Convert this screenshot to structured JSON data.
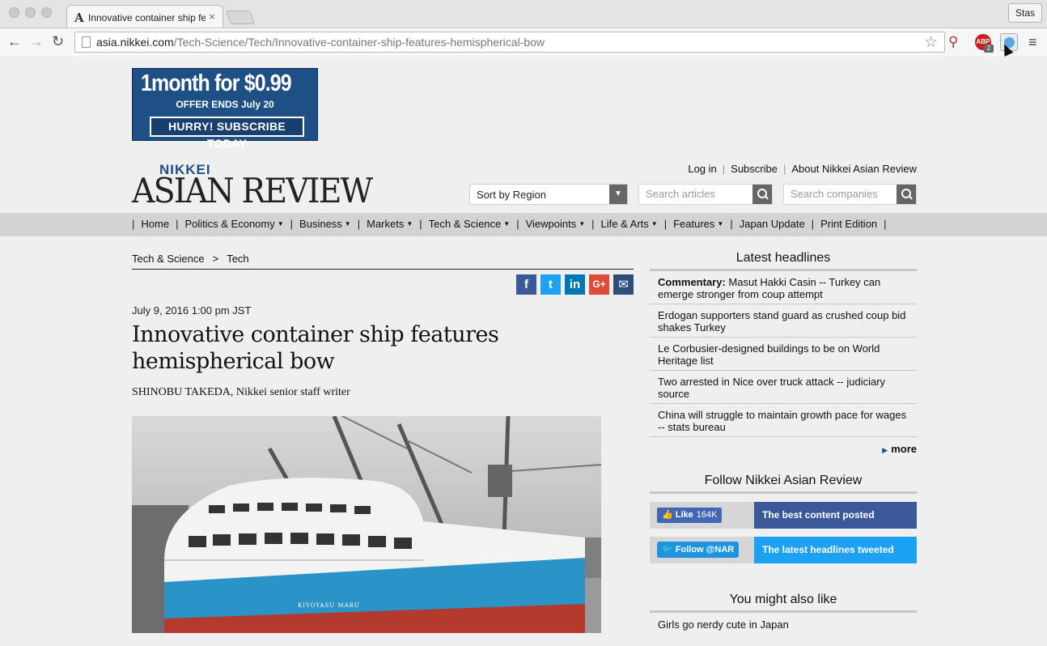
{
  "browser": {
    "tab_title": "Innovative container ship features hemispherical bow",
    "tab_close": "×",
    "profile": "Stas",
    "url_host": "asia.nikkei.com",
    "url_path": "/Tech-Science/Tech/Innovative-container-ship-features-hemispherical-bow",
    "back_icon": "←",
    "forward_icon": "→",
    "reload_icon": "↻",
    "star_icon": "☆",
    "abp_label": "ABP",
    "abp_count": "2",
    "menu_icon": "≡"
  },
  "ad": {
    "line1": "1month for $0.99",
    "line2": "OFFER ENDS July 20",
    "button": "HURRY! SUBSCRIBE TODAY"
  },
  "header": {
    "logo_top": "NIKKEI",
    "logo_main": "ASIAN REVIEW",
    "links": [
      "Log in",
      "Subscribe",
      "About Nikkei Asian Review"
    ],
    "region_select": "Sort by Region",
    "search_articles_placeholder": "Search articles",
    "search_companies_placeholder": "Search companies"
  },
  "nav": {
    "items": [
      {
        "label": "Home",
        "dropdown": false
      },
      {
        "label": "Politics & Economy",
        "dropdown": true
      },
      {
        "label": "Business",
        "dropdown": true
      },
      {
        "label": "Markets",
        "dropdown": true
      },
      {
        "label": "Tech & Science",
        "dropdown": true
      },
      {
        "label": "Viewpoints",
        "dropdown": true
      },
      {
        "label": "Life & Arts",
        "dropdown": true
      },
      {
        "label": "Features",
        "dropdown": true
      },
      {
        "label": "Japan Update",
        "dropdown": false
      },
      {
        "label": "Print Edition",
        "dropdown": false
      }
    ]
  },
  "article": {
    "breadcrumb": [
      "Tech & Science",
      "Tech"
    ],
    "breadcrumb_sep": ">",
    "share": [
      {
        "label": "f",
        "color": "#3b5998",
        "name": "facebook-share-icon"
      },
      {
        "label": "t",
        "color": "#1da1f2",
        "name": "twitter-share-icon"
      },
      {
        "label": "in",
        "color": "#0077b5",
        "name": "linkedin-share-icon"
      },
      {
        "label": "G+",
        "color": "#dd4b39",
        "name": "googleplus-share-icon"
      },
      {
        "label": "✉",
        "color": "#2f4f7a",
        "name": "email-share-icon"
      }
    ],
    "date": "July 9, 2016 1:00 pm JST",
    "headline": "Innovative container ship features hemispherical bow",
    "byline": "SHINOBU TAKEDA, Nikkei senior staff writer",
    "photo_ship_name": "KIYOYASU MARU"
  },
  "sidebar": {
    "latest_title": "Latest headlines",
    "headlines": [
      {
        "prefix": "Commentary:",
        "text": " Masut Hakki Casin -- Turkey can emerge stronger from coup attempt"
      },
      {
        "prefix": "",
        "text": "Erdogan supporters stand guard as crushed coup bid shakes Turkey"
      },
      {
        "prefix": "",
        "text": "Le Corbusier-designed buildings to be on World Heritage list"
      },
      {
        "prefix": "",
        "text": "Two arrested in Nice over truck attack -- judiciary source"
      },
      {
        "prefix": "",
        "text": "China will struggle to maintain growth pace for wages -- stats bureau"
      }
    ],
    "more": "more",
    "follow_title": "Follow Nikkei Asian Review",
    "fb_like": "Like",
    "fb_count": "164K",
    "fb_tagline": "The best content posted",
    "tw_follow": "Follow @NAR",
    "tw_tagline": "The latest headlines tweeted",
    "also_title": "You might also like",
    "also_items": [
      "Girls go nerdy cute in Japan"
    ]
  },
  "colors": {
    "brand_blue": "#1d4e86",
    "facebook": "#3b5998",
    "twitter": "#1da1f2"
  }
}
